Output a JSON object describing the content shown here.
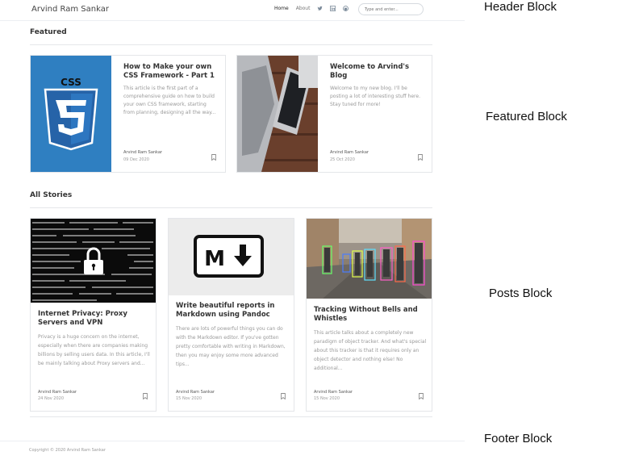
{
  "header": {
    "site_title": "Arvind Ram Sankar",
    "nav": {
      "home": "Home",
      "about": "About"
    },
    "social_icons": [
      "twitter-icon",
      "linkedin-icon",
      "github-icon"
    ],
    "search_placeholder": "Type and enter..."
  },
  "annotations": {
    "header": "Header Block",
    "featured": "Featured Block",
    "posts": "Posts Block",
    "footer": "Footer Block"
  },
  "featured": {
    "heading": "Featured",
    "cards": [
      {
        "title": "How to Make your own CSS Framework - Part 1",
        "excerpt": "This article is the first part of a comprehensive guide on how to build your own CSS framework, starting from planning, designing all the way...",
        "author": "Arvind Ram Sankar",
        "date": "09 Dec 2020",
        "image": "css3-logo",
        "image_text": "CSS"
      },
      {
        "title": "Welcome to Arvind's Blog",
        "excerpt": "Welcome to my new blog. I'll be posting a lot of interesting stuff here. Stay tuned for more!",
        "author": "Arvind Ram Sankar",
        "date": "25 Oct 2020",
        "image": "laptop-phone-photo"
      }
    ]
  },
  "stories": {
    "heading": "All Stories",
    "posts": [
      {
        "title": "Internet Privacy: Proxy Servers and VPN",
        "excerpt": "Privacy is a huge concern on the internet, especially when there are companies making billions by selling users data. In this article, I'll be mainly talking about Proxy servers and...",
        "author": "Arvind Ram Sankar",
        "date": "24 Nov 2020",
        "image": "padlock-code-photo"
      },
      {
        "title": "Write beautiful reports in Markdown using Pandoc",
        "excerpt": "There are lots of powerful things you can do with the Markdown editor. If you've gotten pretty comfortable with writing in Markdown, then you may enjoy some more advanced tips...",
        "author": "Arvind Ram Sankar",
        "date": "15 Nov 2020",
        "image": "markdown-logo",
        "image_text": "M"
      },
      {
        "title": "Tracking Without Bells and Whistles",
        "excerpt": "This article talks about a completely new paradigm of object tracker. And what's special about this tracker is that it requires only an object detector and nothing else! No additional...",
        "author": "Arvind Ram Sankar",
        "date": "15 Nov 2020",
        "image": "street-tracking-photo"
      }
    ]
  },
  "footer": {
    "copyright": "Copyright © 2020 Arvind Ram Sankar"
  },
  "colors": {
    "css_blue": "#2f7fc1",
    "css_blue_dark": "#2263a3",
    "tracking_box": "#d9ff3d"
  }
}
